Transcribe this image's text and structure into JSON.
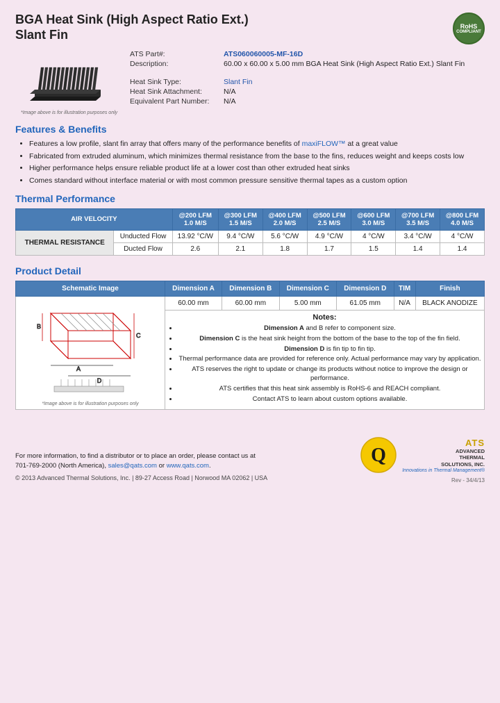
{
  "header": {
    "title_line1": "BGA Heat Sink (High Aspect Ratio Ext.)",
    "title_line2": "Slant Fin",
    "rohs": "RoHS\nCOMPLIANT"
  },
  "product": {
    "part_label": "ATS Part#:",
    "part_number": "ATS060060005-MF-16D",
    "description_label": "Description:",
    "description_value": "60.00 x 60.00 x 5.00 mm  BGA Heat Sink (High Aspect Ratio Ext.) Slant Fin",
    "heat_sink_type_label": "Heat Sink Type:",
    "heat_sink_type_value": "Slant Fin",
    "attachment_label": "Heat Sink Attachment:",
    "attachment_value": "N/A",
    "equiv_part_label": "Equivalent Part Number:",
    "equiv_part_value": "N/A",
    "image_caption": "*Image above is for illustration purposes only"
  },
  "features": {
    "title": "Features & Benefits",
    "items": [
      "Features a low profile, slant fin array that offers many of the performance benefits of maxiFLOW™ at a great value",
      "Fabricated from extruded aluminum, which minimizes thermal resistance from the base to the fins, reduces weight and keeps costs low",
      "Higher performance helps ensure reliable product life at a lower cost than other extruded heat sinks",
      "Comes standard without interface material or with most common pressure sensitive thermal tapes as a custom option"
    ]
  },
  "thermal_performance": {
    "title": "Thermal Performance",
    "table": {
      "col_headers": [
        "AIR VELOCITY",
        "@200 LFM\n1.0 M/S",
        "@300 LFM\n1.5 M/S",
        "@400 LFM\n2.0 M/S",
        "@500 LFM\n2.5 M/S",
        "@600 LFM\n3.0 M/S",
        "@700 LFM\n3.5 M/S",
        "@800 LFM\n4.0 M/S"
      ],
      "row_label": "THERMAL RESISTANCE",
      "rows": [
        {
          "label": "Unducted Flow",
          "values": [
            "13.92 °C/W",
            "9.4 °C/W",
            "5.6 °C/W",
            "4.9 °C/W",
            "4 °C/W",
            "3.4 °C/W",
            "4 °C/W"
          ]
        },
        {
          "label": "Ducted Flow",
          "values": [
            "2.6",
            "2.1",
            "1.8",
            "1.7",
            "1.5",
            "1.4",
            "1.4"
          ]
        }
      ]
    }
  },
  "product_detail": {
    "title": "Product Detail",
    "table": {
      "headers": [
        "Schematic Image",
        "Dimension A",
        "Dimension B",
        "Dimension C",
        "Dimension D",
        "TIM",
        "Finish"
      ],
      "dim_values": [
        "60.00 mm",
        "60.00 mm",
        "5.00 mm",
        "61.05 mm",
        "N/A",
        "BLACK ANODIZE"
      ],
      "schematic_caption": "*Image above is for illustration purposes only"
    },
    "notes": {
      "title": "Notes:",
      "items": [
        "Dimension A and B refer to component size.",
        "Dimension C is the heat sink height from the bottom of the base to the top of the fin field.",
        "Dimension D is fin tip to fin tip.",
        "Thermal performance data are provided for reference only. Actual performance may vary by application.",
        "ATS reserves the right to update or change its products without notice to improve the design or performance.",
        "ATS certifies that this heat sink assembly is RoHS-6 and REACH compliant.",
        "Contact ATS to learn about custom options available."
      ]
    }
  },
  "footer": {
    "contact_text": "For more information, to find a distributor or to place an order, please contact us at\n701-769-2000 (North America),",
    "email": "sales@qats.com",
    "or_text": "or",
    "website": "www.qats.com",
    "copyright": "© 2013 Advanced Thermal Solutions, Inc.  |  89-27 Access Road  |  Norwood MA  02062  |  USA",
    "ats_name": "ATS",
    "ats_full_line1": "ADVANCED",
    "ats_full_line2": "THERMAL",
    "ats_full_line3": "SOLUTIONS, INC.",
    "ats_tagline": "Innovations in Thermal Management®",
    "rev": "Rev - 34/4/13"
  }
}
